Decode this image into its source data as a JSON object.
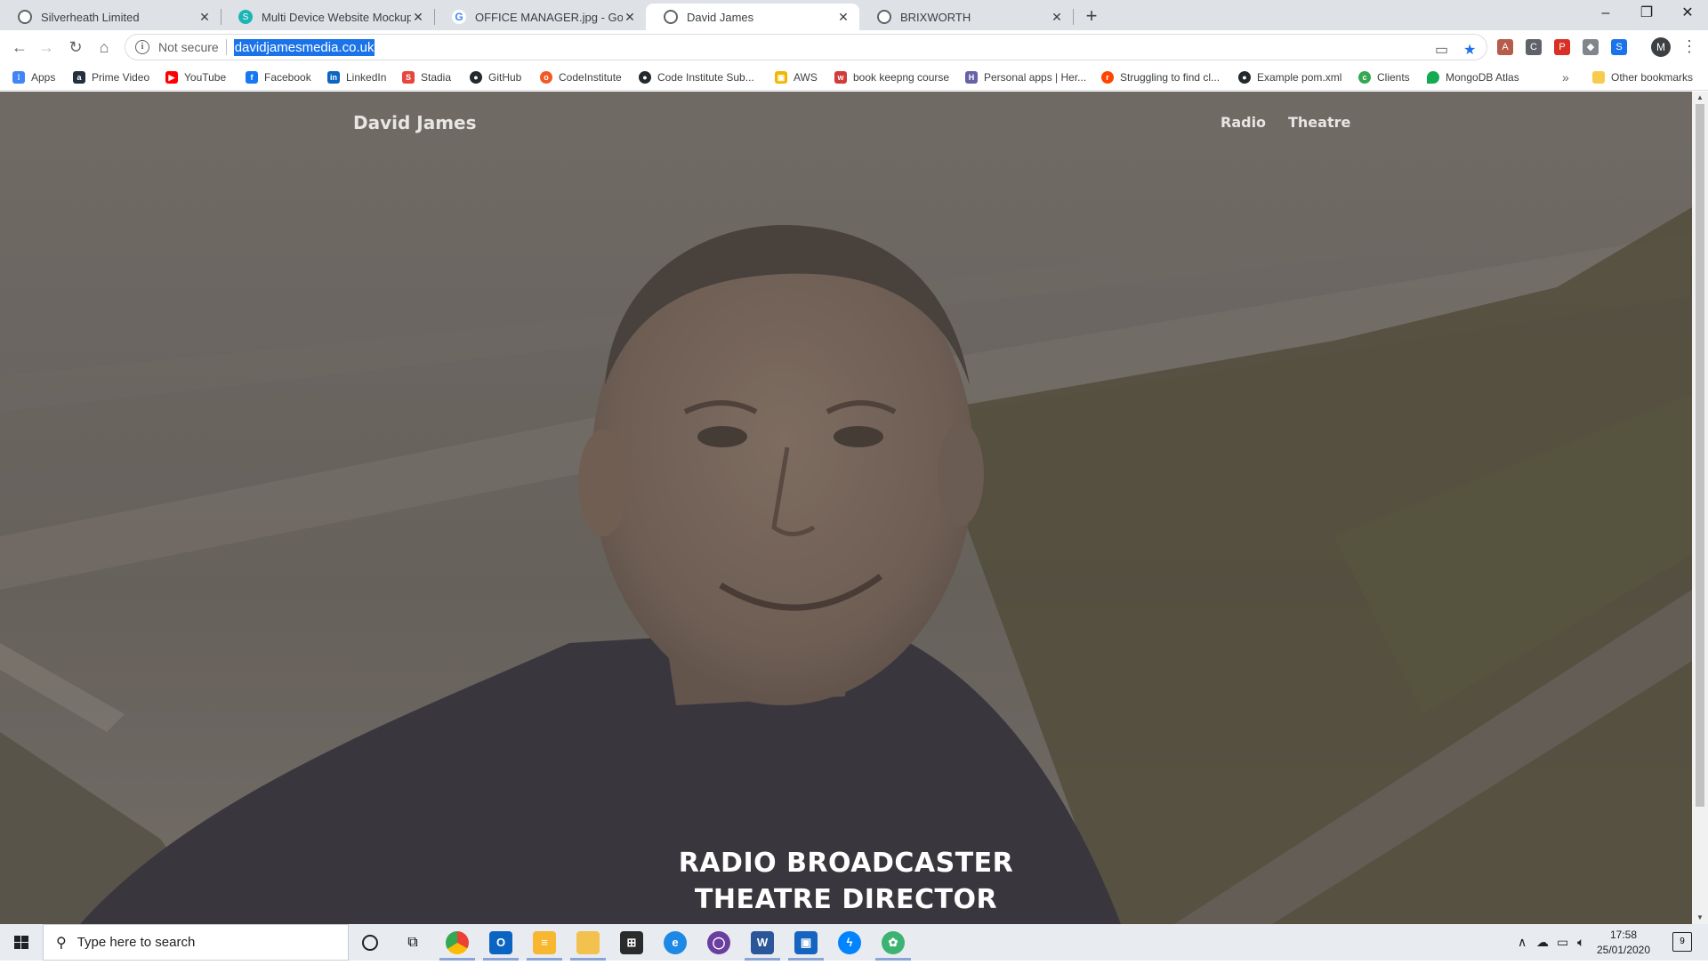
{
  "tabs": [
    {
      "title": "Silverheath Limited",
      "active": false
    },
    {
      "title": "Multi Device Website Mockup Ge",
      "active": false
    },
    {
      "title": "OFFICE MANAGER.jpg - Google S",
      "active": false
    },
    {
      "title": "David James",
      "active": true
    },
    {
      "title": "BRIXWORTH",
      "active": false
    }
  ],
  "address_bar": {
    "security_label": "Not secure",
    "url": "davidjamesmedia.co.uk"
  },
  "bookmarks": [
    {
      "label": "Apps",
      "icon": "apps-grid-icon"
    },
    {
      "label": "Prime Video",
      "icon": "amazon-icon"
    },
    {
      "label": "YouTube",
      "icon": "youtube-icon"
    },
    {
      "label": "Facebook",
      "icon": "facebook-icon"
    },
    {
      "label": "LinkedIn",
      "icon": "linkedin-icon"
    },
    {
      "label": "Stadia",
      "icon": "stadia-icon"
    },
    {
      "label": "GitHub",
      "icon": "github-icon"
    },
    {
      "label": "CodeInstitute",
      "icon": "codeinstitute-icon"
    },
    {
      "label": "Code Institute Sub...",
      "icon": "github-icon"
    },
    {
      "label": "AWS",
      "icon": "aws-icon"
    },
    {
      "label": "book keepng course",
      "icon": "course-icon"
    },
    {
      "label": "Personal apps | Her...",
      "icon": "heroku-icon"
    },
    {
      "label": "Struggling to find cl...",
      "icon": "reddit-icon"
    },
    {
      "label": "Example pom.xml",
      "icon": "github-icon"
    },
    {
      "label": "Clients",
      "icon": "clients-icon"
    },
    {
      "label": "MongoDB Atlas",
      "icon": "mongodb-icon"
    }
  ],
  "other_bookmarks": "Other bookmarks",
  "site": {
    "title": "David James",
    "nav": [
      "Radio",
      "Theatre"
    ],
    "headline_1": "RADIO BROADCASTER",
    "headline_2": "THEATRE DIRECTOR"
  },
  "taskbar": {
    "search_placeholder": "Type here to search",
    "time": "17:58",
    "date": "25/01/2020",
    "notification_count": "9"
  },
  "colors": {
    "accent": "#1a73e8",
    "overlay": "#6b6460"
  }
}
